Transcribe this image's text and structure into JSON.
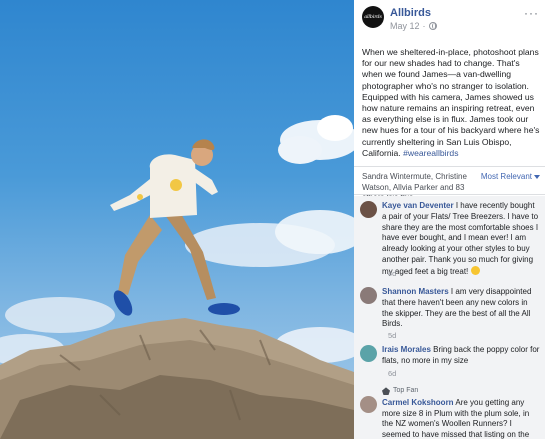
{
  "post": {
    "page_name": "Allbirds",
    "logo_text": "allbirds",
    "date": "May 12",
    "more": "···",
    "caption": "When we sheltered-in-place, photoshoot plans for our new shades had to change. That's when we found James—a van-dwelling photographer who's no stranger to isolation. Equipped with his camera, James showed us how nature remains an inspiring retreat, even as everything else is in flux. James took our new hues for a tour of his backyard where he's currently sheltering in San Luis Obispo, California.",
    "hashtag": "#weareallbirds"
  },
  "likes": {
    "text": "Sandra Wintermute, Christine Watson, Allvia Parker and 83 others like this.",
    "sort_label": "Most Relevant"
  },
  "comments": [
    {
      "name": "Kaye van Deventer",
      "text": "I have recently bought a pair of your Flats/ Tree Breezers. I have to share they are the most comfortable shoes I have ever bought, and I mean ever! I am already looking at your other styles to buy another pair. Thank you so much for giving my aged feet a big treat!",
      "time": "4d",
      "avatar_color": "#6b5146"
    },
    {
      "name": "Shannon Masters",
      "text": "I am very disappointed that there haven't been any new colors in the skipper. They are the best of all the All Birds.",
      "time": "5d",
      "avatar_color": "#8a7a78"
    },
    {
      "name": "Irais Morales",
      "text": "Bring back the poppy color for flats, no more in my size",
      "time": "6d",
      "avatar_color": "#5ba3a8"
    },
    {
      "badge": "Top Fan",
      "name": "Carmel Kokshoorn",
      "text": "Are you getting any more size 8 in Plum with the plum sole, in the NZ women's Woollen Runners? I seemed to have missed that listing on the website!",
      "avatar_color": "#a48f86"
    }
  ],
  "colors": {
    "link": "#385898",
    "accent": "#4267b2",
    "comments_bg": "#f2f3f5"
  }
}
